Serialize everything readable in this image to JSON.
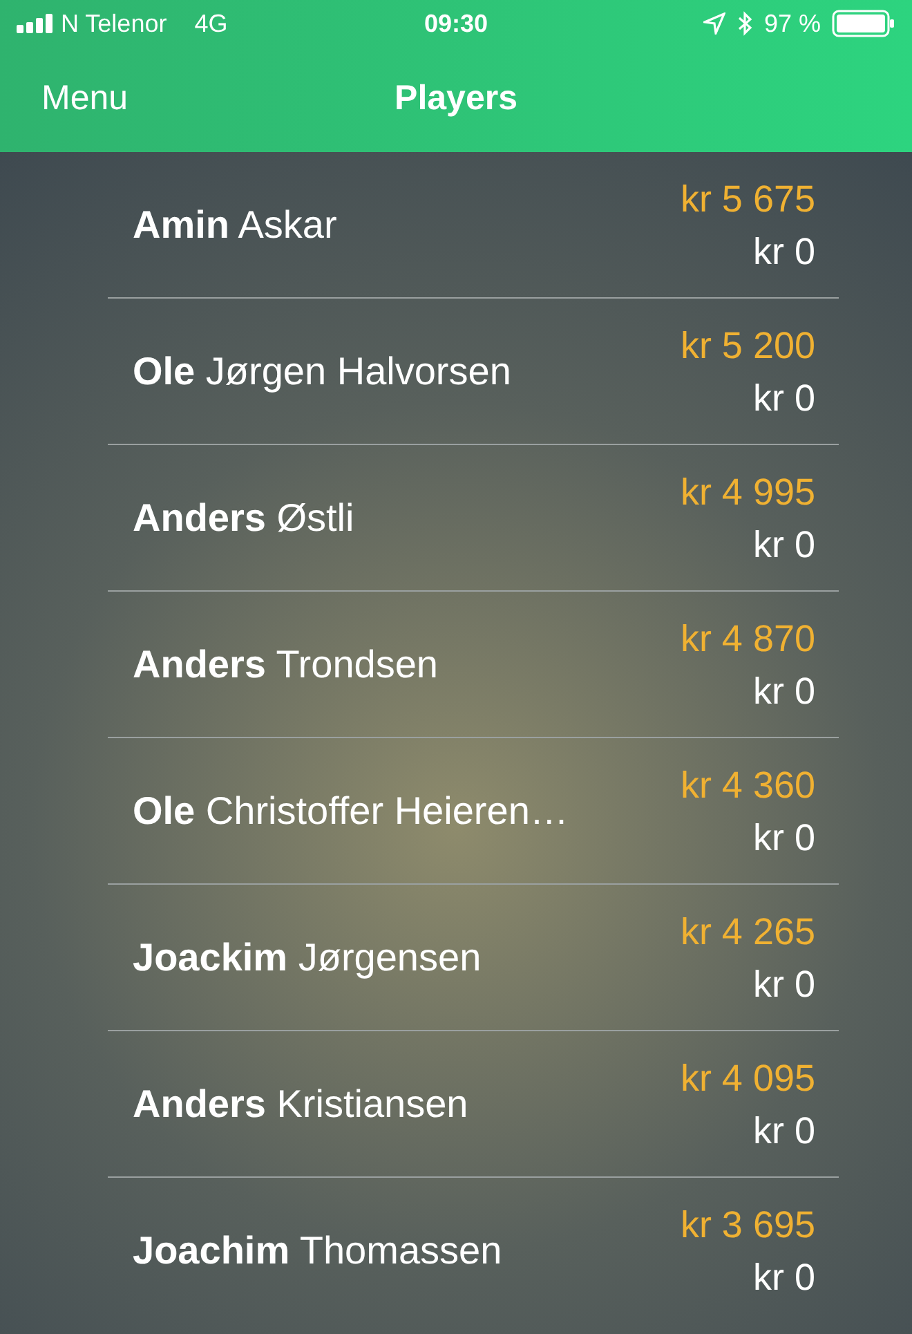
{
  "status_bar": {
    "carrier": "N Telenor",
    "network": "4G",
    "time": "09:30",
    "battery": "97 %"
  },
  "nav": {
    "left": "Menu",
    "title": "Players"
  },
  "players": [
    {
      "name": "**Amin** Askar",
      "amount": "kr 5 675",
      "balance": "kr 0"
    },
    {
      "name": "**Ole** Jørgen Halvorsen",
      "amount": "kr 5 200",
      "balance": "kr 0"
    },
    {
      "name": "**Anders** Østli",
      "amount": "kr 4 995",
      "balance": "kr 0"
    },
    {
      "name": "**Anders** Trondsen",
      "amount": "kr 4 870",
      "balance": "kr 0"
    },
    {
      "name": "**Ole** Christoffer Heieren…",
      "amount": "kr 4 360",
      "balance": "kr 0"
    },
    {
      "name": "**Joackim** Jørgensen",
      "amount": "kr 4 265",
      "balance": "kr 0"
    },
    {
      "name": "**Anders** Kristiansen",
      "amount": "kr 4 095",
      "balance": "kr 0"
    },
    {
      "name": "**Joachim** Thomassen",
      "amount": "kr 3 695",
      "balance": "kr 0"
    }
  ]
}
